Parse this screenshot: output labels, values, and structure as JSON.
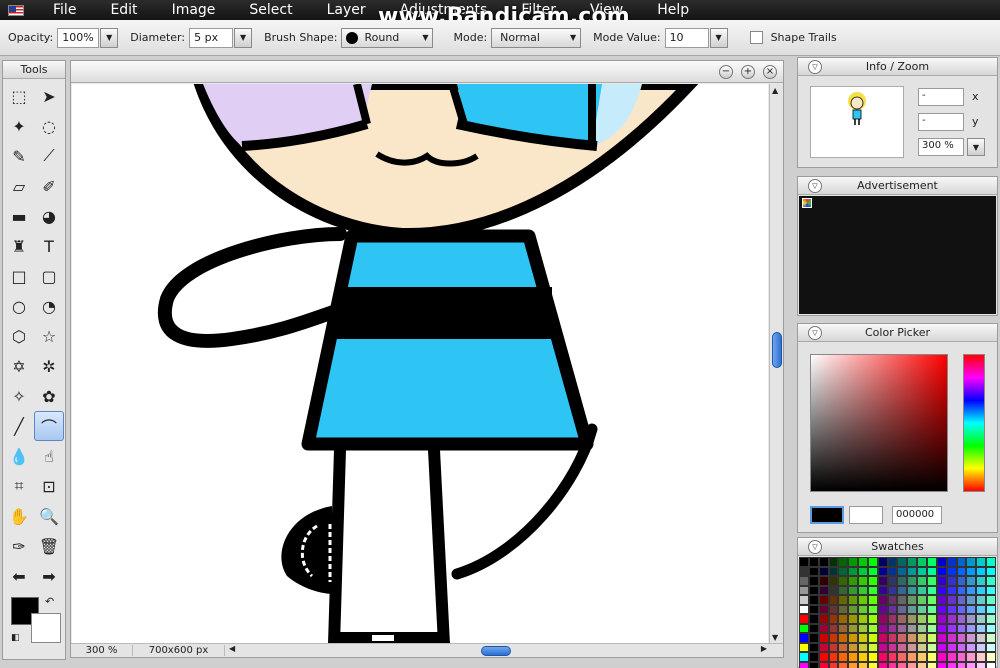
{
  "menubar": {
    "items": [
      "File",
      "Edit",
      "Image",
      "Select",
      "Layer",
      "Adjustments",
      "Filter",
      "View",
      "Help"
    ]
  },
  "watermark": "www.Bandicam.com",
  "options": {
    "opacity_label": "Opacity:",
    "opacity_value": "100%",
    "diameter_label": "Diameter:",
    "diameter_value": "5 px",
    "brush_shape_label": "Brush Shape:",
    "brush_shape_value": "Round",
    "mode_label": "Mode:",
    "mode_value": "Normal",
    "mode_value_label": "Mode Value:",
    "mode_value_value": "10",
    "shape_trails_label": "Shape Trails"
  },
  "tools": {
    "title": "Tools",
    "items": [
      {
        "name": "marquee-select-tool",
        "icon": "⬚"
      },
      {
        "name": "move-tool",
        "icon": "➤"
      },
      {
        "name": "magic-wand-tool",
        "icon": "✦"
      },
      {
        "name": "lasso-tool",
        "icon": "◌"
      },
      {
        "name": "pencil-tool",
        "icon": "✎"
      },
      {
        "name": "brush-tool",
        "icon": "⟋"
      },
      {
        "name": "eraser-tool",
        "icon": "▱"
      },
      {
        "name": "color-replace-tool",
        "icon": "✐"
      },
      {
        "name": "gradient-tool",
        "icon": "▬"
      },
      {
        "name": "paint-bucket-tool",
        "icon": "◕"
      },
      {
        "name": "clone-stamp-tool",
        "icon": "♜"
      },
      {
        "name": "text-tool",
        "icon": "T"
      },
      {
        "name": "rectangle-tool",
        "icon": "□"
      },
      {
        "name": "rounded-rectangle-tool",
        "icon": "▢"
      },
      {
        "name": "ellipse-tool",
        "icon": "○"
      },
      {
        "name": "pie-tool",
        "icon": "◔"
      },
      {
        "name": "hexagon-tool",
        "icon": "⬡"
      },
      {
        "name": "star-tool",
        "icon": "☆"
      },
      {
        "name": "star6-tool",
        "icon": "✡"
      },
      {
        "name": "starburst-tool",
        "icon": "✲"
      },
      {
        "name": "custom-shape-tool",
        "icon": "✧"
      },
      {
        "name": "flower-tool",
        "icon": "✿"
      },
      {
        "name": "line-tool",
        "icon": "╱"
      },
      {
        "name": "curve-tool",
        "icon": "⌒"
      },
      {
        "name": "blur-tool",
        "icon": "💧"
      },
      {
        "name": "smudge-tool",
        "icon": "☝"
      },
      {
        "name": "crop-tool",
        "icon": "⌗"
      },
      {
        "name": "resize-tool",
        "icon": "⊡"
      },
      {
        "name": "hand-tool",
        "icon": "✋"
      },
      {
        "name": "zoom-tool",
        "icon": "🔍"
      },
      {
        "name": "eyedropper-tool",
        "icon": "✑"
      },
      {
        "name": "trash-tool",
        "icon": "🗑"
      },
      {
        "name": "undo-tool",
        "icon": "⬅"
      },
      {
        "name": "redo-tool",
        "icon": "➡"
      }
    ],
    "active_index": 23
  },
  "canvas": {
    "zoom": "300 %",
    "size": "700x600 px",
    "colors": {
      "skin": "#fae6c8",
      "lavender": "#e0cef5",
      "dress": "#2ec5f5",
      "lightblue": "#c6ecfb",
      "outline": "#000000"
    }
  },
  "info_zoom": {
    "title": "Info / Zoom",
    "x_value": "-",
    "x_label": "x",
    "y_value": "-",
    "y_label": "y",
    "zoom_value": "300 %"
  },
  "advert": {
    "title": "Advertisement"
  },
  "color_picker": {
    "title": "Color Picker",
    "hex_value": "000000"
  },
  "swatches": {
    "title": "Swatches"
  }
}
